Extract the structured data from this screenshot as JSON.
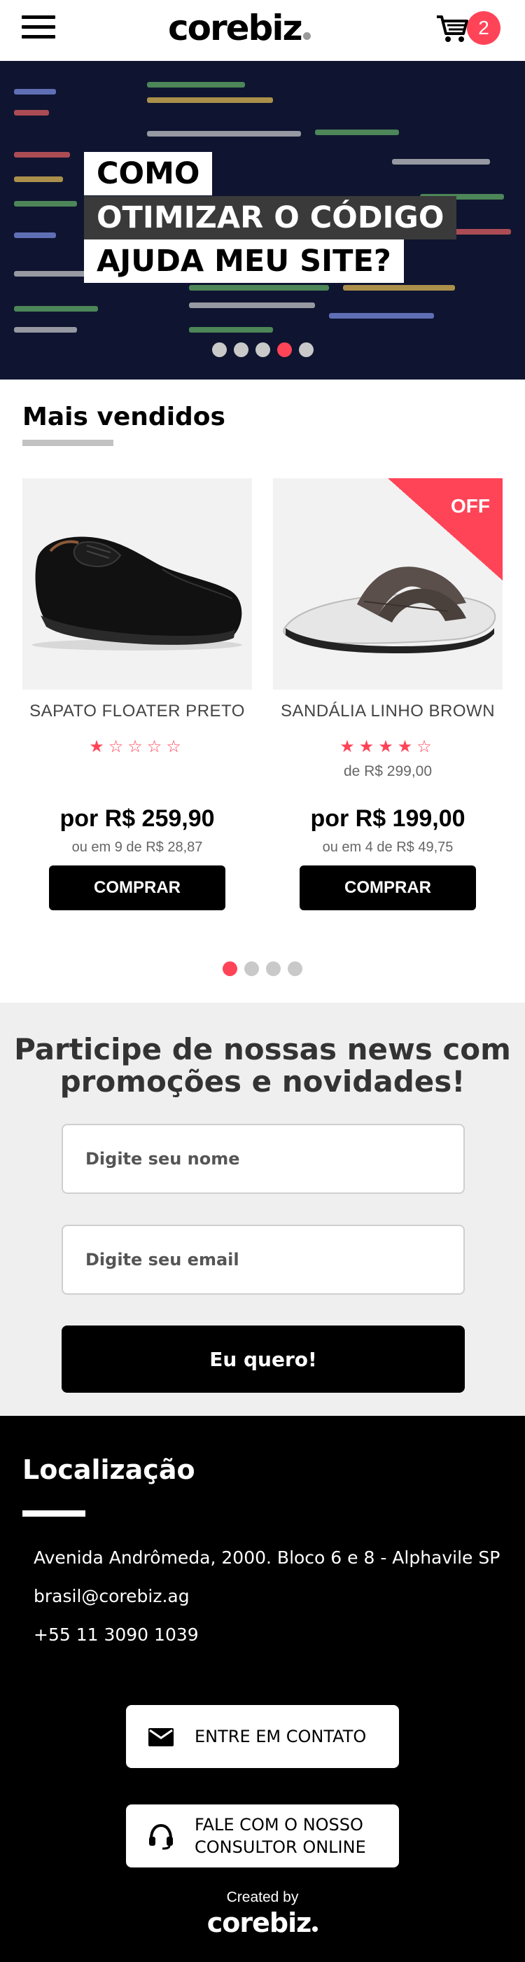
{
  "header": {
    "logo": "corebiz",
    "cart_count": "2"
  },
  "hero": {
    "line1": "COMO",
    "line2": "OTIMIZAR O CÓDIGO",
    "line3": "AJUDA MEU SITE?",
    "slide_count": 5,
    "active_slide": 4
  },
  "bestsellers": {
    "title": "Mais vendidos",
    "products": [
      {
        "name": "SAPATO FLOATER PRETO",
        "stars": "★☆☆☆☆",
        "rating": 1,
        "old_price": "",
        "price": "por R$ 259,90",
        "installments": "ou em 9 de R$ 28,87",
        "buy_label": "COMPRAR",
        "badge": ""
      },
      {
        "name": "SANDÁLIA LINHO BROWN",
        "stars": "★★★★☆",
        "rating": 4,
        "old_price": "de R$ 299,00",
        "price": "por R$ 199,00",
        "installments": "ou em 4 de R$ 49,75",
        "buy_label": "COMPRAR",
        "badge": "OFF"
      }
    ],
    "page_count": 4,
    "active_page": 1
  },
  "newsletter": {
    "title": "Participe de nossas news com promoções e novidades!",
    "name_placeholder": "Digite seu nome",
    "email_placeholder": "Digite seu email",
    "submit_label": "Eu quero!"
  },
  "footer": {
    "title": "Localização",
    "address": "Avenida Andrômeda, 2000. Bloco 6 e 8 - Alphavile SP",
    "email": "brasil@corebiz.ag",
    "phone": "+55 11 3090 1039",
    "contact_button": "ENTRE EM CONTATO",
    "consultant_button_line1": "FALE COM O NOSSO",
    "consultant_button_line2": "CONSULTOR ONLINE",
    "created_by": "Created by",
    "logo": "corebiz"
  },
  "colors": {
    "accent": "#ff4458",
    "dark": "#000000",
    "light_bg": "#efefef"
  }
}
